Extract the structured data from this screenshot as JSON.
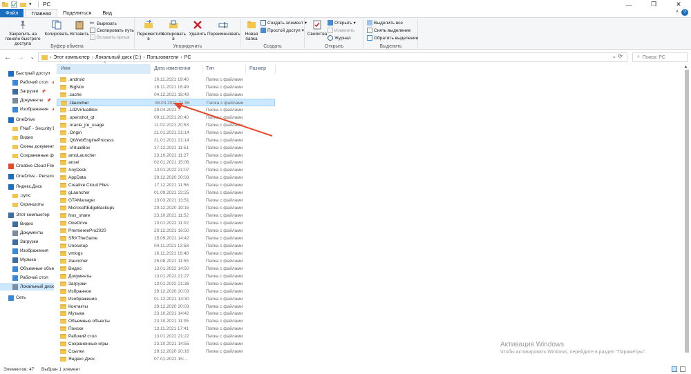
{
  "window": {
    "title": "PC"
  },
  "ribbon_tabs": [
    "Файл",
    "Главная",
    "Поделиться",
    "Вид"
  ],
  "clipboard": {
    "pin_label": "Закрепить на панели быстрого доступа",
    "copy_label": "Копировать",
    "paste_label": "Вставить",
    "cut_label": "Вырезать",
    "copy_path_label": "Скопировать путь",
    "paste_shortcut_label": "Вставить ярлык",
    "group_label": "Буфер обмена"
  },
  "organize": {
    "move_label": "Переместить в",
    "copyto_label": "Копировать в",
    "delete_label": "Удалить",
    "rename_label": "Переименовать",
    "group_label": "Упорядочить"
  },
  "create": {
    "new_folder_label": "Новая папка",
    "new_item_label": "Создать элемент",
    "easy_access_label": "Простой доступ",
    "group_label": "Создать"
  },
  "open": {
    "properties_label": "Свойства",
    "open_label": "Открыть",
    "edit_label": "Изменить",
    "history_label": "Журнал",
    "group_label": "Открыть"
  },
  "select": {
    "select_all_label": "Выделить все",
    "select_none_label": "Снять выделение",
    "invert_label": "Обратить выделение",
    "group_label": "Выделить"
  },
  "address": {
    "crumbs": [
      "Этот компьютер",
      "Локальный диск (C:)",
      "Пользователи",
      "PC"
    ],
    "search_placeholder": "Поиск: PC"
  },
  "nav_pane": [
    {
      "label": "Быстрый доступ",
      "icon": "star-icon"
    },
    {
      "label": "Рабочий стол",
      "icon": "desktop-icon",
      "pinned": true
    },
    {
      "label": "Загрузки",
      "icon": "download-icon",
      "pinned": true
    },
    {
      "label": "Документы",
      "icon": "document-icon",
      "pinned": true
    },
    {
      "label": "Изображения",
      "icon": "pictures-icon",
      "pinned": true
    },
    {
      "label": "OneDrive",
      "icon": "cloud-icon"
    },
    {
      "label": "FNaF - Security Br",
      "icon": "folder-icon"
    },
    {
      "label": "Видео",
      "icon": "folder-icon"
    },
    {
      "label": "Скины документ",
      "icon": "folder-icon"
    },
    {
      "label": "Сохраненные фо",
      "icon": "folder-icon"
    },
    {
      "label": "Creative Cloud Files",
      "icon": "creative-cloud-icon"
    },
    {
      "label": "OneDrive - Persona",
      "icon": "cloud-icon"
    },
    {
      "label": "Яндекс.Диск",
      "icon": "yandex-disk-icon"
    },
    {
      "label": ".sync",
      "icon": "folder-icon"
    },
    {
      "label": "Скриншоты",
      "icon": "folder-icon"
    },
    {
      "label": "Этот компьютер",
      "icon": "computer-icon"
    },
    {
      "label": "Видео",
      "icon": "video-icon"
    },
    {
      "label": "Документы",
      "icon": "document-icon"
    },
    {
      "label": "Загрузки",
      "icon": "download-icon"
    },
    {
      "label": "Изображения",
      "icon": "pictures-icon"
    },
    {
      "label": "Музыка",
      "icon": "music-icon"
    },
    {
      "label": "Объемные объек",
      "icon": "3d-objects-icon"
    },
    {
      "label": "Рабочий стол",
      "icon": "desktop-icon"
    },
    {
      "label": "Локальный диск",
      "icon": "drive-icon",
      "selected": true
    },
    {
      "label": "Сеть",
      "icon": "network-icon"
    }
  ],
  "columns": [
    "Имя",
    "Дата изменения",
    "Тип",
    "Размер"
  ],
  "files": [
    {
      "name": ".android",
      "date": "10.11.2021 19:40",
      "type": "Папка с файлами"
    },
    {
      "name": ".BigNox",
      "date": "16.11.2021 16:49",
      "type": "Папка с файлами"
    },
    {
      "name": ".cache",
      "date": "04.12.2021 18:49",
      "type": "Папка с файлами"
    },
    {
      "name": ".tlauncher",
      "date": "08.03.2021 21:56",
      "type": "Папка с файлами",
      "selected": true
    },
    {
      "name": ".Ld2VirtualBox",
      "date": "29.04.2021 ..",
      "type": "Папка с файлами"
    },
    {
      "name": ".openshot_qt",
      "date": "09.11.2021 20:40",
      "type": "Папка с файлами"
    },
    {
      "name": ".oracle_jre_usage",
      "date": "11.02.2021 20:53",
      "type": "Папка с файлами"
    },
    {
      "name": ".Origin",
      "date": "21.01.2021 21:14",
      "type": "Папка с файлами"
    },
    {
      "name": ".QtWebEngineProcess",
      "date": "21.01.2021 21:14",
      "type": "Папка с файлами"
    },
    {
      "name": ".VirtualBox",
      "date": "27.12.2021 11:51",
      "type": "Папка с файлами"
    },
    {
      "name": "amoLauncher",
      "date": "23.10.2021 11:27",
      "type": "Папка с файлами"
    },
    {
      "name": "ansel",
      "date": "02.01.2021 15:06",
      "type": "Папка с файлами"
    },
    {
      "name": "AnyDesk",
      "date": "13.01.2022 21:07",
      "type": "Папка с файлами"
    },
    {
      "name": "AppData",
      "date": "29.12.2020 20:03",
      "type": "Папка с файлами"
    },
    {
      "name": "Creative Cloud Files",
      "date": "17.12.2021 11:56",
      "type": "Папка с файлами"
    },
    {
      "name": "gLauncher",
      "date": "01.09.2021 22:25",
      "type": "Папка с файлами"
    },
    {
      "name": "GTAManager",
      "date": "13.03.2021 13:51",
      "type": "Папка с файлами"
    },
    {
      "name": "MicrosoftEdgeBackups",
      "date": "29.12.2020 19:15",
      "type": "Папка с файлами"
    },
    {
      "name": "Nox_share",
      "date": "23.10.2021 11:52",
      "type": "Папка с файлами"
    },
    {
      "name": "OneDrive",
      "date": "13.01.2022 11:02",
      "type": "Папка с файлами"
    },
    {
      "name": "PremiereePro2020",
      "date": "20.12.2021 16:50",
      "type": "Папка с файлами"
    },
    {
      "name": "SRXTheGame",
      "date": "15.09.2021 14:42",
      "type": "Папка с файлами"
    },
    {
      "name": "Unosetup",
      "date": "04.11.2021 13:58",
      "type": "Папка с файлами"
    },
    {
      "name": "vmlogs",
      "date": "16.11.2021 16:48",
      "type": "Папка с файлами"
    },
    {
      "name": "zlauncher",
      "date": "25.08.2021 11:55",
      "type": "Папка с файлами"
    },
    {
      "name": "Видео",
      "date": "13.01.2022 14:50",
      "type": "Папка с файлами"
    },
    {
      "name": "Документы",
      "date": "13.01.2022 21:27",
      "type": "Папка с файлами"
    },
    {
      "name": "Загрузки",
      "date": "13.01.2022 21:36",
      "type": "Папка с файлами"
    },
    {
      "name": "Избранное",
      "date": "29.12.2020 20:03",
      "type": "Папка с файлами"
    },
    {
      "name": "Изображения",
      "date": "01.12.2021 14:30",
      "type": "Папка с файлами"
    },
    {
      "name": "Контакты",
      "date": "29.12.2020 20:03",
      "type": "Папка с файлами"
    },
    {
      "name": "Музыка",
      "date": "23.10.2021 14:42",
      "type": "Папка с файлами"
    },
    {
      "name": "Объемные объекты",
      "date": "23.10.2021 11:05",
      "type": "Папка с файлами"
    },
    {
      "name": "Поиски",
      "date": "13.11.2021 17:41",
      "type": "Папка с файлами"
    },
    {
      "name": "Рабочий стол",
      "date": "13.01.2022 21:22",
      "type": "Папка с файлами"
    },
    {
      "name": "Сохраненные игры",
      "date": "23.10.2021 14:55",
      "type": "Папка с файлами"
    },
    {
      "name": "Ссылки",
      "date": "29.12.2020 20:16",
      "type": "Папка с файлами"
    },
    {
      "name": "Яндекс.Диск",
      "date": "07.01.2022 15:...",
      "type": ""
    }
  ],
  "status": {
    "count": "Элементов: 47",
    "selected": "Выбран 1 элемент"
  },
  "watermark": {
    "line1": "Активация Windows",
    "line2": "Чтобы активировать Windows, перейдите в раздел \"Параметры\"."
  }
}
